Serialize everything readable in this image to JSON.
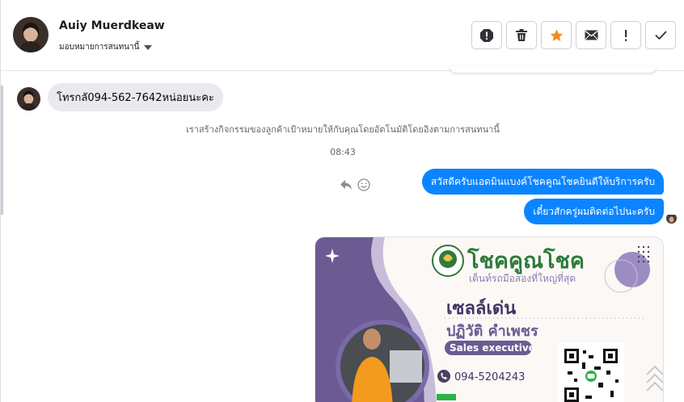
{
  "header": {
    "contact_name": "Auiy Muerdkeaw",
    "assign_label": "มอบหมายการสนทนานี้",
    "actions": [
      {
        "name": "spam-icon",
        "label": "!"
      },
      {
        "name": "trash-icon",
        "label": ""
      },
      {
        "name": "star-icon",
        "label": ""
      },
      {
        "name": "mail-icon",
        "label": ""
      },
      {
        "name": "important-icon",
        "label": "!"
      },
      {
        "name": "check-icon",
        "label": ""
      }
    ]
  },
  "thread": {
    "incoming_message": "โทรกลั094-562-7642หน่อยนะคะ",
    "system_note": "เราสร้างกิจกรรมของลูกค้าเป้าหมายให้กับคุณโดยอัตโนมัติโดยอิงตามการสนทนานี้",
    "timestamp": "08:43",
    "outgoing_messages": [
      "สวัสดีครับแอดมินแบงค์โชคคูณโชคยินดีให้บริการครับ",
      "เดี๋ยวสักครู่ผมติดต่อไปนะครับ"
    ]
  },
  "card": {
    "brand_title": "โชคคูณโชค",
    "brand_slogan": "เต็นท์รถมือสองที่ใหญ่ที่สุด",
    "logo_text": "โชคคูณโชค",
    "person_first": "เซลล์เด่น",
    "person_name": "ปฏิวัติ  คำเพชร",
    "role": "Sales executive",
    "phone": "094-5204243",
    "colors": {
      "purple": "#6c5a93",
      "light_purple": "#9c8cc2",
      "accent": "#7a6aa8",
      "green": "#1e7d3a"
    }
  },
  "colors": {
    "bubble_out": "#0b84ff",
    "bubble_in": "#e9eaed",
    "star": "#f28b21"
  }
}
